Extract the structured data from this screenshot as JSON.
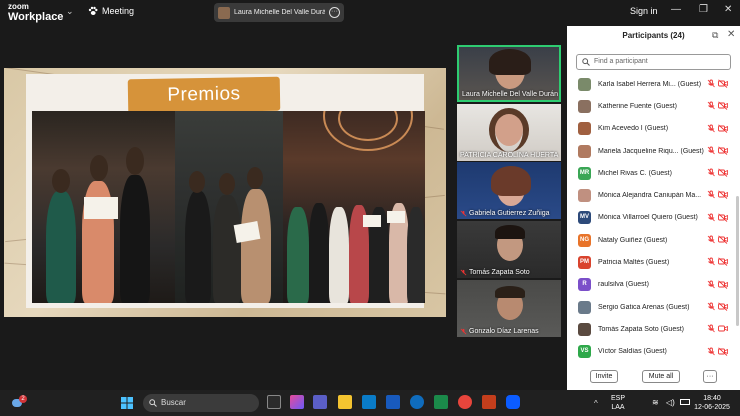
{
  "app": {
    "logo_line1": "zoom",
    "logo_line2": "Workplace",
    "meeting_label": "Meeting",
    "share_pill_text": "Laura Michelle Del Valle Durán's s",
    "signin_label": "Sign in"
  },
  "slide": {
    "title": "Premios"
  },
  "video_tiles": [
    {
      "name": "Laura Michelle Del Valle Durán",
      "muted": false,
      "active": true
    },
    {
      "name": "PATRICIA CAROLINA HUERTA",
      "muted": false,
      "active": false
    },
    {
      "name": "Gabriela Gutierrez Zuñiga",
      "muted": true,
      "active": false
    },
    {
      "name": "Tomás Zapata Soto",
      "muted": true,
      "active": false
    },
    {
      "name": "Gonzalo Díaz Larenas",
      "muted": true,
      "active": false
    }
  ],
  "participants_panel": {
    "title": "Participants (24)",
    "search_placeholder": "Find a participant",
    "invite_label": "Invite",
    "mute_all_label": "Mute all",
    "more_label": "···",
    "items": [
      {
        "name": "Karla Isabel Herrera Mi... (Guest)",
        "initials": "",
        "color": "#7a8a6a",
        "video": false
      },
      {
        "name": "Katherine Fuente (Guest)",
        "initials": "",
        "color": "#8a7060",
        "video": false
      },
      {
        "name": "Kim Acevedo I (Guest)",
        "initials": "",
        "color": "#a06040",
        "video": false
      },
      {
        "name": "Mariela Jacqueline Riqu... (Guest)",
        "initials": "",
        "color": "#b07a60",
        "video": false
      },
      {
        "name": "Michel Rivas C. (Guest)",
        "initials": "MR",
        "color": "#3aa655",
        "video": false
      },
      {
        "name": "Mónica Alejandra Caniupán Ma...",
        "initials": "",
        "color": "#c09080",
        "video": false
      },
      {
        "name": "Mónica Villarroel Quiero (Guest)",
        "initials": "MV",
        "color": "#2d4a7a",
        "video": false
      },
      {
        "name": "Nataly Guiñez (Guest)",
        "initials": "NG",
        "color": "#e8742a",
        "video": false
      },
      {
        "name": "Patricia Maltés (Guest)",
        "initials": "PM",
        "color": "#d9442e",
        "video": false
      },
      {
        "name": "raulsilva (Guest)",
        "initials": "R",
        "color": "#7b4fc9",
        "video": false
      },
      {
        "name": "Sergio Gatica Arenas (Guest)",
        "initials": "",
        "color": "#6a7a8a",
        "video": false
      },
      {
        "name": "Tomás Zapata Soto (Guest)",
        "initials": "",
        "color": "#5a4a40",
        "video": true
      },
      {
        "name": "Víctor Saldías (Guest)",
        "initials": "VS",
        "color": "#2ea84a",
        "video": false
      }
    ]
  },
  "taskbar": {
    "search_placeholder": "Buscar",
    "notification_count": "2",
    "lang_line1": "ESP",
    "lang_line2": "LAA",
    "time": "18:40",
    "date": "12-06-2025"
  }
}
